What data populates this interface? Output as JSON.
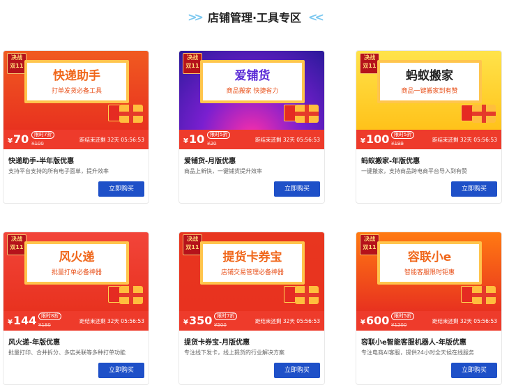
{
  "header": {
    "title": "店铺管理·工具专区",
    "left_icon": "double-chevron-right-icon",
    "right_icon": "double-chevron-left-icon"
  },
  "badge_text": "决战\n双11",
  "buy_label": "立即购买",
  "products": [
    {
      "name_on_banner": "快递助手",
      "slogan": "打单发货必备工具",
      "price": "70",
      "discount": "限时7折",
      "original": "¥100",
      "countdown": "距结束还剩 32天 05:56:53",
      "title": "快递助手-半年版优惠",
      "desc": "支持平台支持的所有电子面单，提升效率",
      "bg": "#f05a20",
      "panel_text_color": "#f0671b"
    },
    {
      "name_on_banner": "爱铺货",
      "slogan": "商品搬家 快捷省力",
      "price": "10",
      "discount": "限时5折",
      "original": "¥20",
      "countdown": "距结束还剩 32天 05:56:53",
      "title": "爱铺货-月版优惠",
      "desc": "商品上新快，一键铺货提升效率",
      "bg": "#4a1fb8",
      "panel_text_color": "#5b2bd6"
    },
    {
      "name_on_banner": "蚂蚁搬家",
      "slogan": "商品一键搬家到有赞",
      "price": "100",
      "discount": "限时5折",
      "original": "¥199",
      "countdown": "距结束还剩 32天 05:56:53",
      "title": "蚂蚁搬家-年版优惠",
      "desc": "一键搬家，支持商品跨电商平台导入到有赞",
      "bg": "#ffd21e",
      "panel_text_color": "#222222"
    },
    {
      "name_on_banner": "风火递",
      "slogan": "批量打单必备神器",
      "price": "144",
      "discount": "限时8折",
      "original": "¥180",
      "countdown": "距结束还剩 32天 05:56:53",
      "title": "风火递-年版优惠",
      "desc": "批量打印、合并拆分、多店关联等多种打单功能",
      "bg": "#f2453a",
      "panel_text_color": "#f0671b"
    },
    {
      "name_on_banner": "提货卡券宝",
      "slogan": "店铺交易管理必备神器",
      "price": "350",
      "discount": "限时7折",
      "original": "¥500",
      "countdown": "距结束还剩 32天 05:56:53",
      "title": "提货卡券宝-月版优惠",
      "desc": "专注线下发卡，线上提货的行业解决方案",
      "bg": "#e8361f",
      "panel_text_color": "#f0671b"
    },
    {
      "name_on_banner": "容联小e",
      "slogan": "智能客服限时钜惠",
      "price": "600",
      "discount": "限时5折",
      "original": "¥1200",
      "countdown": "距结束还剩 32天 05:56:53",
      "title": "容联小e智能客服机器人-年版优惠",
      "desc": "专注电商AI客服，提供24小时全天候在线服务",
      "bg": "#ff7a12",
      "panel_text_color": "#f0671b"
    }
  ]
}
